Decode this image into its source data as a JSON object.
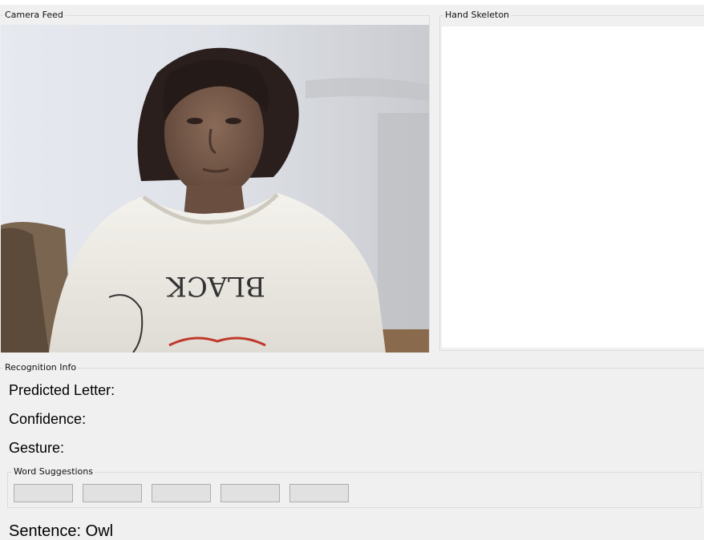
{
  "camera": {
    "title": "Camera Feed",
    "shirt_text": "BLACK"
  },
  "skeleton": {
    "title": "Hand Skeleton"
  },
  "recognition": {
    "title": "Recognition Info",
    "predicted_letter_label": "Predicted Letter:",
    "predicted_letter_value": "",
    "confidence_label": "Confidence:",
    "confidence_value": "",
    "gesture_label": "Gesture:",
    "gesture_value": "",
    "word_suggestions": {
      "title": "Word Suggestions",
      "buttons": [
        "",
        "",
        "",
        "",
        ""
      ]
    },
    "sentence_label": "Sentence:",
    "sentence_value": "Owl"
  },
  "colors": {
    "window_bg": "#f0f0f0",
    "panel_bg": "#ffffff",
    "groupbox_border": "#dcdcdc",
    "button_bg": "#e1e1e1",
    "button_border": "#adadad"
  }
}
